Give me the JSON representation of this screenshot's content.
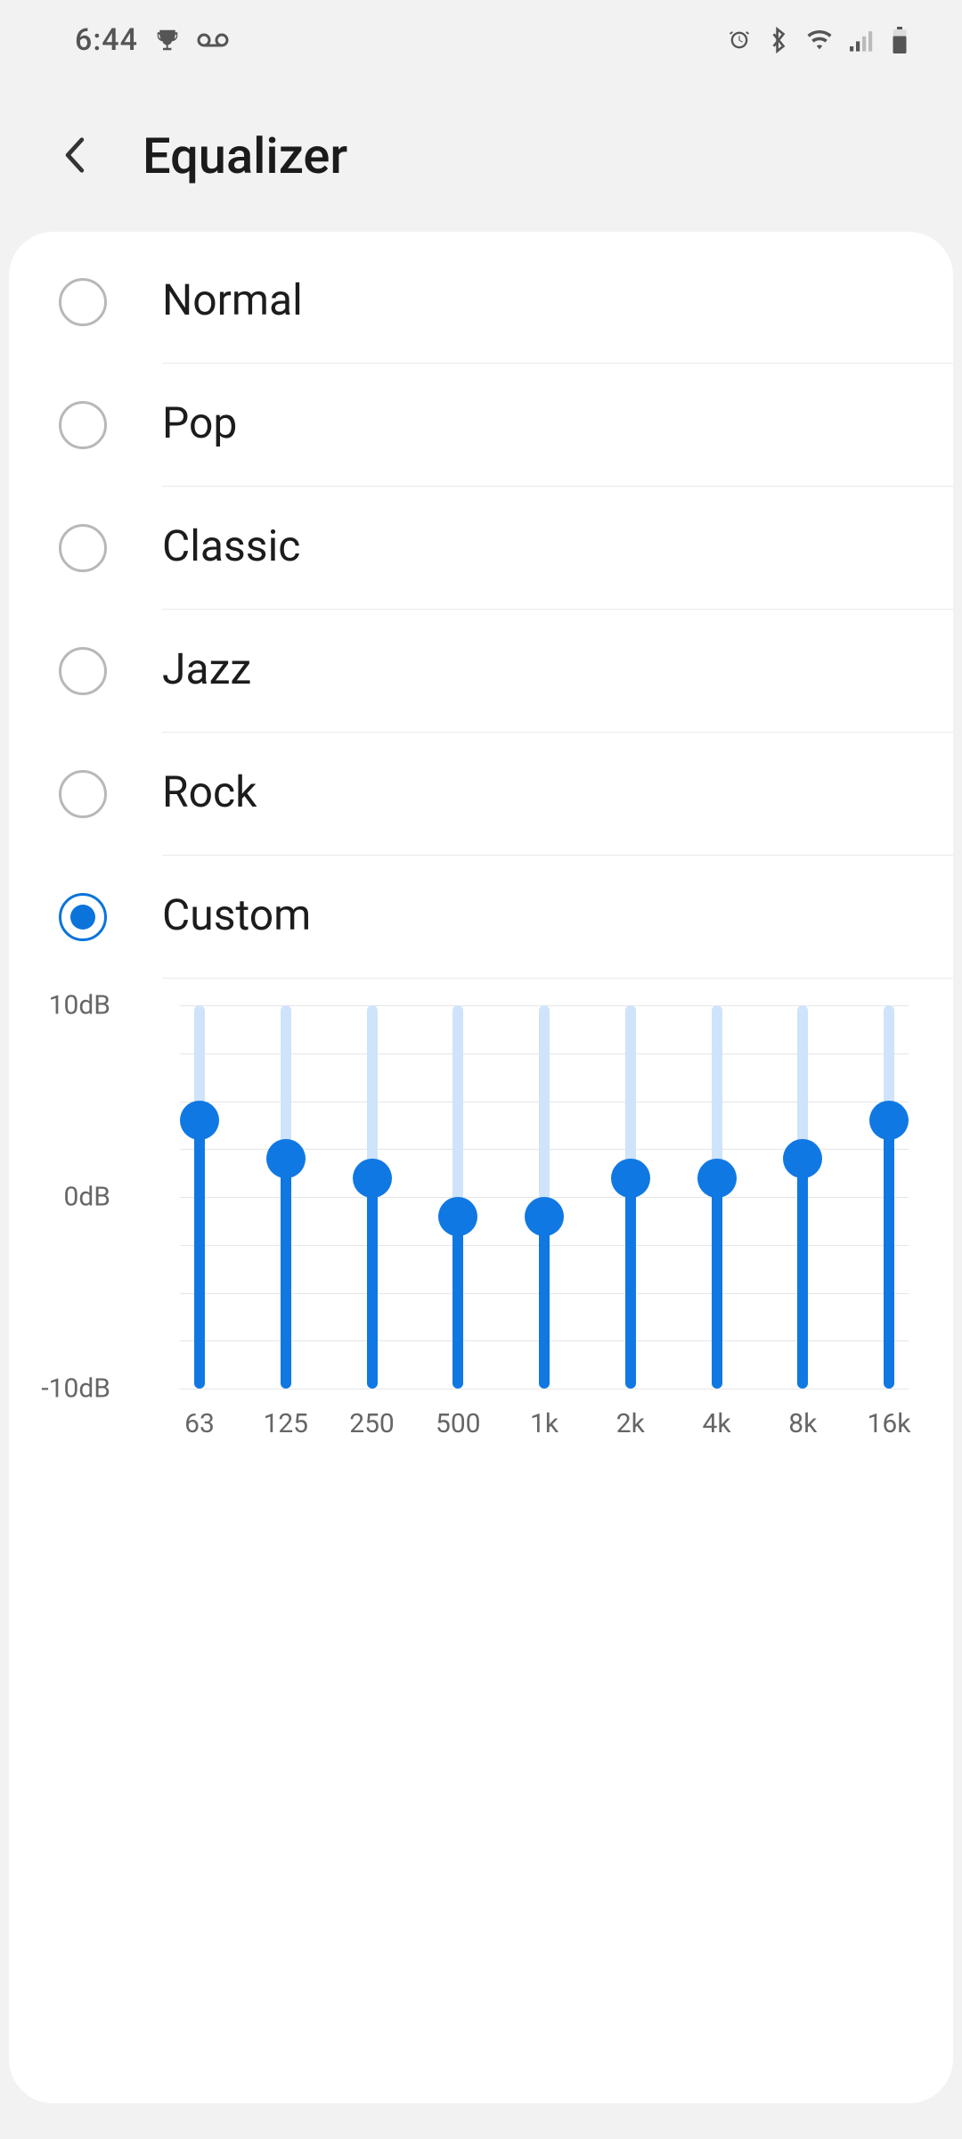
{
  "status": {
    "time": "6:44",
    "icons_left": [
      "trophy-icon",
      "voicemail-icon"
    ],
    "icons_right": [
      "alarm-icon",
      "bluetooth-icon",
      "wifi-icon",
      "signal-icon",
      "battery-icon"
    ]
  },
  "header": {
    "title": "Equalizer"
  },
  "presets": [
    {
      "label": "Normal",
      "selected": false
    },
    {
      "label": "Pop",
      "selected": false
    },
    {
      "label": "Classic",
      "selected": false
    },
    {
      "label": "Jazz",
      "selected": false
    },
    {
      "label": "Rock",
      "selected": false
    },
    {
      "label": "Custom",
      "selected": true
    }
  ],
  "chart_data": {
    "type": "bar",
    "categories": [
      "63",
      "125",
      "250",
      "500",
      "1k",
      "2k",
      "4k",
      "8k",
      "16k"
    ],
    "values": [
      4,
      2,
      1,
      -1,
      -1,
      1,
      1,
      2,
      4
    ],
    "ylabel": "dB",
    "ylim": [
      -10,
      10
    ],
    "y_ticks": [
      {
        "value": 10,
        "label": "10dB"
      },
      {
        "value": 0,
        "label": "0dB"
      },
      {
        "value": -10,
        "label": "-10dB"
      }
    ],
    "accent": "#1078e3",
    "track": "#cfe3fb"
  }
}
